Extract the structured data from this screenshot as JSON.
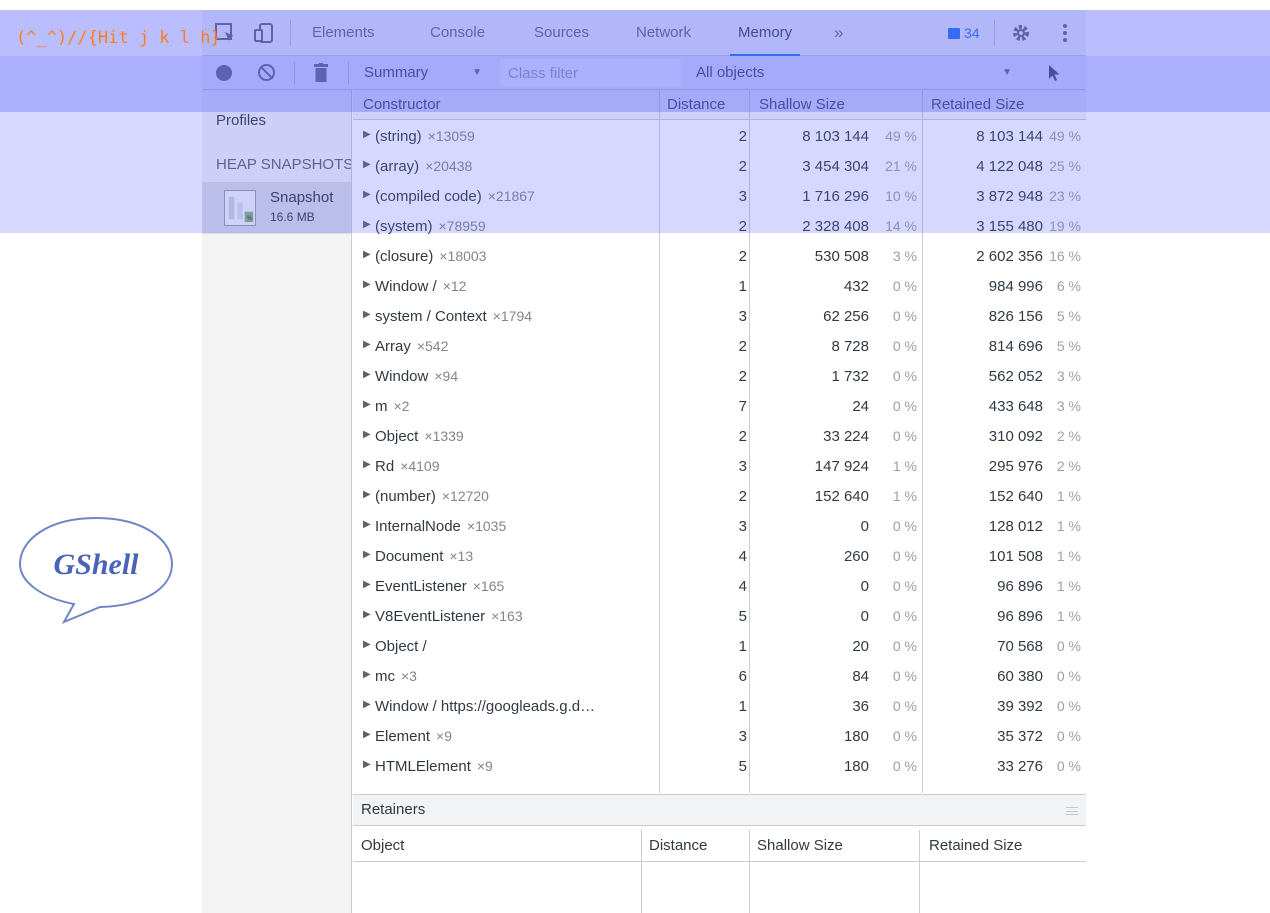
{
  "overlay": {
    "text": "(^_^)//{Hit j k l h}"
  },
  "logo": {
    "text": "GShell"
  },
  "tabbar": {
    "tabs": [
      "Elements",
      "Console",
      "Sources",
      "Network",
      "Memory"
    ],
    "active_tab": "Memory",
    "overflow": "»",
    "issues_count": "34"
  },
  "toolbar": {
    "view": "Summary",
    "class_filter_placeholder": "Class filter",
    "objects": "All objects"
  },
  "sidebar": {
    "title": "Profiles",
    "section": "HEAP SNAPSHOTS",
    "snapshot": {
      "name": "Snapshot",
      "size": "16.6 MB"
    }
  },
  "grid": {
    "headers": {
      "constructor": "Constructor",
      "distance": "Distance",
      "shallow": "Shallow Size",
      "retained": "Retained Size"
    },
    "rows": [
      {
        "name": "(string)",
        "count": "×13059",
        "distance": "2",
        "shallow": "8 103 144",
        "shallow_pct": "49 %",
        "retained": "8 103 144",
        "retained_pct": "49 %"
      },
      {
        "name": "(array)",
        "count": "×20438",
        "distance": "2",
        "shallow": "3 454 304",
        "shallow_pct": "21 %",
        "retained": "4 122 048",
        "retained_pct": "25 %"
      },
      {
        "name": "(compiled code)",
        "count": "×21867",
        "distance": "3",
        "shallow": "1 716 296",
        "shallow_pct": "10 %",
        "retained": "3 872 948",
        "retained_pct": "23 %"
      },
      {
        "name": "(system)",
        "count": "×78959",
        "distance": "2",
        "shallow": "2 328 408",
        "shallow_pct": "14 %",
        "retained": "3 155 480",
        "retained_pct": "19 %"
      },
      {
        "name": "(closure)",
        "count": "×18003",
        "distance": "2",
        "shallow": "530 508",
        "shallow_pct": "3 %",
        "retained": "2 602 356",
        "retained_pct": "16 %"
      },
      {
        "name": "Window /",
        "count": "×12",
        "distance": "1",
        "shallow": "432",
        "shallow_pct": "0 %",
        "retained": "984 996",
        "retained_pct": "6 %"
      },
      {
        "name": "system / Context",
        "count": "×1794",
        "distance": "3",
        "shallow": "62 256",
        "shallow_pct": "0 %",
        "retained": "826 156",
        "retained_pct": "5 %"
      },
      {
        "name": "Array",
        "count": "×542",
        "distance": "2",
        "shallow": "8 728",
        "shallow_pct": "0 %",
        "retained": "814 696",
        "retained_pct": "5 %"
      },
      {
        "name": "Window",
        "count": "×94",
        "distance": "2",
        "shallow": "1 732",
        "shallow_pct": "0 %",
        "retained": "562 052",
        "retained_pct": "3 %"
      },
      {
        "name": "m",
        "count": "×2",
        "distance": "7",
        "shallow": "24",
        "shallow_pct": "0 %",
        "retained": "433 648",
        "retained_pct": "3 %"
      },
      {
        "name": "Object",
        "count": "×1339",
        "distance": "2",
        "shallow": "33 224",
        "shallow_pct": "0 %",
        "retained": "310 092",
        "retained_pct": "2 %"
      },
      {
        "name": "Rd",
        "count": "×4109",
        "distance": "3",
        "shallow": "147 924",
        "shallow_pct": "1 %",
        "retained": "295 976",
        "retained_pct": "2 %"
      },
      {
        "name": "(number)",
        "count": "×12720",
        "distance": "2",
        "shallow": "152 640",
        "shallow_pct": "1 %",
        "retained": "152 640",
        "retained_pct": "1 %"
      },
      {
        "name": "InternalNode",
        "count": "×1035",
        "distance": "3",
        "shallow": "0",
        "shallow_pct": "0 %",
        "retained": "128 012",
        "retained_pct": "1 %"
      },
      {
        "name": "Document",
        "count": "×13",
        "distance": "4",
        "shallow": "260",
        "shallow_pct": "0 %",
        "retained": "101 508",
        "retained_pct": "1 %"
      },
      {
        "name": "EventListener",
        "count": "×165",
        "distance": "4",
        "shallow": "0",
        "shallow_pct": "0 %",
        "retained": "96 896",
        "retained_pct": "1 %"
      },
      {
        "name": "V8EventListener",
        "count": "×163",
        "distance": "5",
        "shallow": "0",
        "shallow_pct": "0 %",
        "retained": "96 896",
        "retained_pct": "1 %"
      },
      {
        "name": "Object /",
        "count": "",
        "distance": "1",
        "shallow": "20",
        "shallow_pct": "0 %",
        "retained": "70 568",
        "retained_pct": "0 %"
      },
      {
        "name": "mc",
        "count": "×3",
        "distance": "6",
        "shallow": "84",
        "shallow_pct": "0 %",
        "retained": "60 380",
        "retained_pct": "0 %"
      },
      {
        "name": "Window / https://googleads.g.d…",
        "count": "",
        "distance": "1",
        "shallow": "36",
        "shallow_pct": "0 %",
        "retained": "39 392",
        "retained_pct": "0 %"
      },
      {
        "name": "Element",
        "count": "×9",
        "distance": "3",
        "shallow": "180",
        "shallow_pct": "0 %",
        "retained": "35 372",
        "retained_pct": "0 %"
      },
      {
        "name": "HTMLElement",
        "count": "×9",
        "distance": "5",
        "shallow": "180",
        "shallow_pct": "0 %",
        "retained": "33 276",
        "retained_pct": "0 %"
      }
    ]
  },
  "retainers": {
    "title": "Retainers",
    "headers": {
      "object": "Object",
      "distance": "Distance",
      "shallow": "Shallow Size",
      "retained": "Retained Size"
    }
  }
}
